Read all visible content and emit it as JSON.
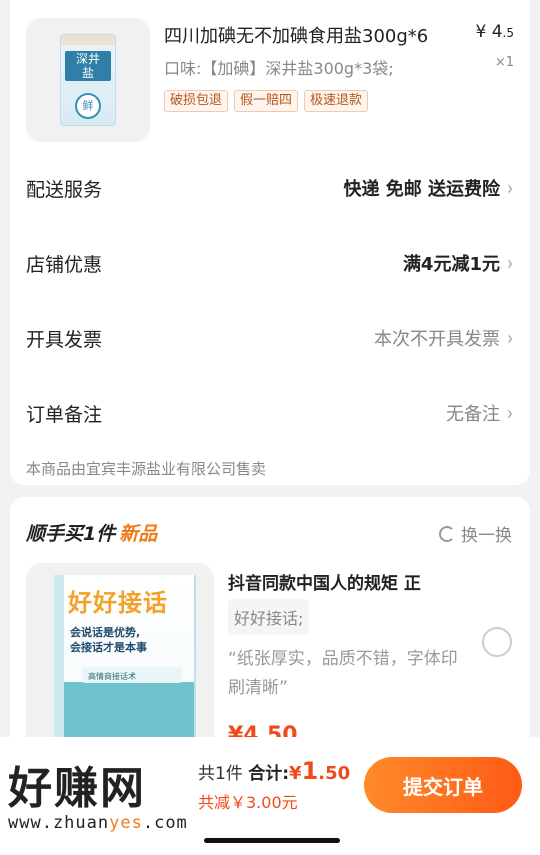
{
  "product": {
    "title": "四川加碘无不加碘食用盐300g*6",
    "price_symbol": "¥",
    "price_int": "4",
    "price_dec": ".5",
    "variant": "口味:【加碘】深井盐300g*3袋;",
    "qty": "×1",
    "thumb": {
      "brand_line1": "深井",
      "brand_line2": "盐",
      "fresh": "鲜"
    },
    "tags": [
      "破损包退",
      "假一赔四",
      "极速退款"
    ]
  },
  "rows": [
    {
      "label": "配送服务",
      "value": "快递 免邮 送运费险",
      "style": "bold"
    },
    {
      "label": "店铺优惠",
      "value": "满4元减1元",
      "style": "bold"
    },
    {
      "label": "开具发票",
      "value": "本次不开具发票",
      "style": "muted"
    },
    {
      "label": "订单备注",
      "value": "无备注",
      "style": "muted"
    }
  ],
  "seller": "本商品由宜宾丰源盐业有限公司售卖",
  "reco": {
    "title": "顺手买1件",
    "title_badge": "新品",
    "swap_label": "换一换",
    "book": {
      "title": "好好接话",
      "subtitle_1": "会说话是优势,",
      "subtitle_2": "会接话才是本事",
      "caption": "高情商接话术"
    },
    "item_title": "抖音同款中国人的规矩 正",
    "item_variant": "好好接话;",
    "quote": "“纸张厚实，品质不错，字体印刷清晰”",
    "price": "¥4.50"
  },
  "bottom": {
    "count": "共1件",
    "total_label": "合计:",
    "total_symbol": "¥",
    "total_int": "1",
    "total_dec": ".50",
    "discount": "共减￥3.00元",
    "submit": "提交订单"
  },
  "watermark": {
    "text": "好赚网",
    "url_a": "www.zhuan",
    "url_hl": "yes",
    "url_b": ".com"
  },
  "colors": {
    "accent": "#f04a1a",
    "button": "#ff6a1f",
    "tag_text": "#b5561a"
  }
}
